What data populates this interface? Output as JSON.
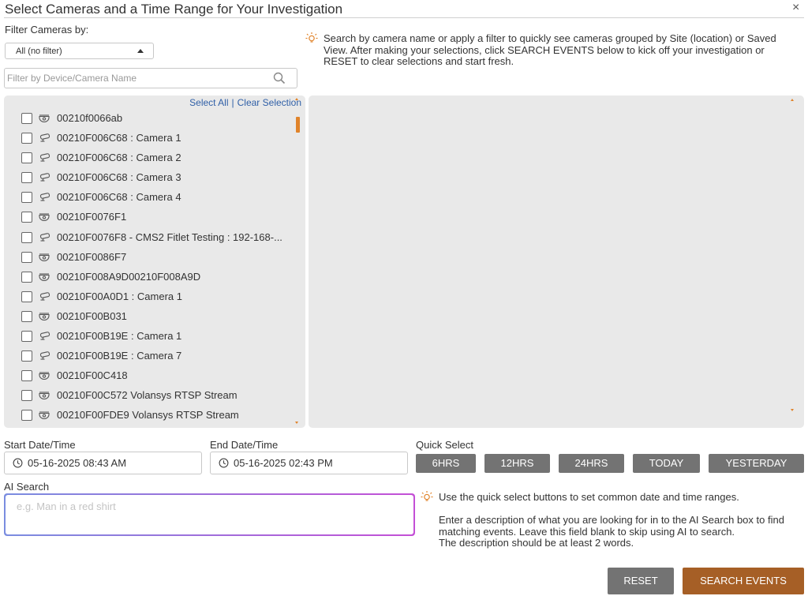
{
  "dialog": {
    "title": "Select Cameras and a Time Range for Your Investigation",
    "close_glyph": "×"
  },
  "filter": {
    "label": "Filter Cameras by:",
    "selected": "All (no filter)",
    "search_placeholder": "Filter by Device/Camera Name"
  },
  "hints": {
    "top_line1": "Search by camera name or apply a filter to quickly see cameras grouped by Site (location) or Saved",
    "top_line2": "View. After making your selections, click SEARCH EVENTS below to kick off your investigation or",
    "top_line3": "RESET to clear selections and start fresh.",
    "quick_select": "Use the quick select buttons to set common date and time ranges.",
    "ai_line1": "Enter a description of what you are looking for in to the AI Search box to find",
    "ai_line2": "matching events. Leave this field blank to skip using AI to search.",
    "ai_line3": "The description should be at least 2 words."
  },
  "camera_panel": {
    "select_all": "Select All",
    "separator": "|",
    "clear_selection": "Clear Selection",
    "cameras": [
      {
        "name": "00210f0066ab",
        "icon": "dome-camera-icon"
      },
      {
        "name": "00210F006C68 : Camera 1",
        "icon": "bullet-camera-icon"
      },
      {
        "name": "00210F006C68 : Camera 2",
        "icon": "bullet-camera-icon"
      },
      {
        "name": "00210F006C68 : Camera 3",
        "icon": "bullet-camera-icon"
      },
      {
        "name": "00210F006C68 : Camera 4",
        "icon": "bullet-camera-icon"
      },
      {
        "name": "00210F0076F1",
        "icon": "dome-camera-icon"
      },
      {
        "name": "00210F0076F8 - CMS2 Fitlet Testing : 192-168-...",
        "icon": "bullet-camera-icon"
      },
      {
        "name": "00210F0086F7",
        "icon": "dome-camera-icon"
      },
      {
        "name": "00210F008A9D00210F008A9D",
        "icon": "dome-camera-icon"
      },
      {
        "name": "00210F00A0D1 : Camera 1",
        "icon": "bullet-camera-icon"
      },
      {
        "name": "00210F00B031",
        "icon": "dome-camera-icon"
      },
      {
        "name": "00210F00B19E : Camera 1",
        "icon": "bullet-camera-icon"
      },
      {
        "name": "00210F00B19E : Camera 7",
        "icon": "bullet-camera-icon"
      },
      {
        "name": "00210F00C418",
        "icon": "dome-camera-icon"
      },
      {
        "name": "00210F00C572 Volansys RTSP Stream",
        "icon": "dome-camera-icon"
      },
      {
        "name": "00210F00FDE9 Volansys RTSP Stream",
        "icon": "dome-camera-icon"
      }
    ]
  },
  "time_range": {
    "start_label": "Start Date/Time",
    "start_value": "05-16-2025 08:43 AM",
    "end_label": "End Date/Time",
    "end_value": "05-16-2025 02:43 PM",
    "quick_label": "Quick Select",
    "quick_buttons": [
      "6HRS",
      "12HRS",
      "24HRS",
      "TODAY",
      "YESTERDAY"
    ]
  },
  "ai_search": {
    "label": "AI Search",
    "placeholder": "e.g. Man in a red shirt"
  },
  "actions": {
    "reset": "RESET",
    "search": "SEARCH EVENTS"
  },
  "colors": {
    "accent_orange": "#e0832a",
    "search_button": "#a65f26",
    "grey_button": "#737373",
    "link_blue": "#2f5fa7",
    "panel_bg": "#e9e9e9"
  }
}
